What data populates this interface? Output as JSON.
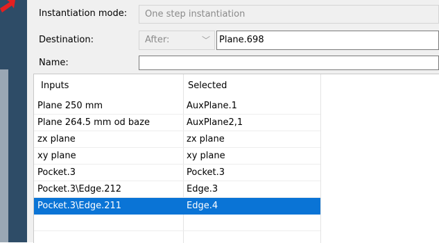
{
  "colors": {
    "window_frame": "#2e4c67",
    "panel_bg": "#f0f0f0",
    "selection": "#0a74d6",
    "arrow": "#e52020"
  },
  "form": {
    "instantiation_mode_label": "Instantiation mode:",
    "instantiation_mode_value": "One step instantiation",
    "destination_label": "Destination:",
    "destination_position": "After:",
    "destination_value": "Plane.698",
    "name_label": "Name:",
    "name_value": ""
  },
  "table": {
    "columns": [
      "Inputs",
      "Selected"
    ],
    "rows": [
      {
        "input": "Plane 250 mm",
        "selected": "AuxPlane.1"
      },
      {
        "input": "Plane 264.5 mm od baze",
        "selected": "AuxPlane2,1"
      },
      {
        "input": "zx plane",
        "selected": "zx plane"
      },
      {
        "input": "xy plane",
        "selected": "xy plane"
      },
      {
        "input": "Pocket.3",
        "selected": "Pocket.3"
      },
      {
        "input": "Pocket.3\\Edge.212",
        "selected": "Edge.3"
      },
      {
        "input": "Pocket.3\\Edge.211",
        "selected": "Edge.4"
      }
    ],
    "selected_row_index": 6
  },
  "icons": {
    "dropdown": "chevron-down-icon",
    "annotation": "red-arrow-icon"
  }
}
